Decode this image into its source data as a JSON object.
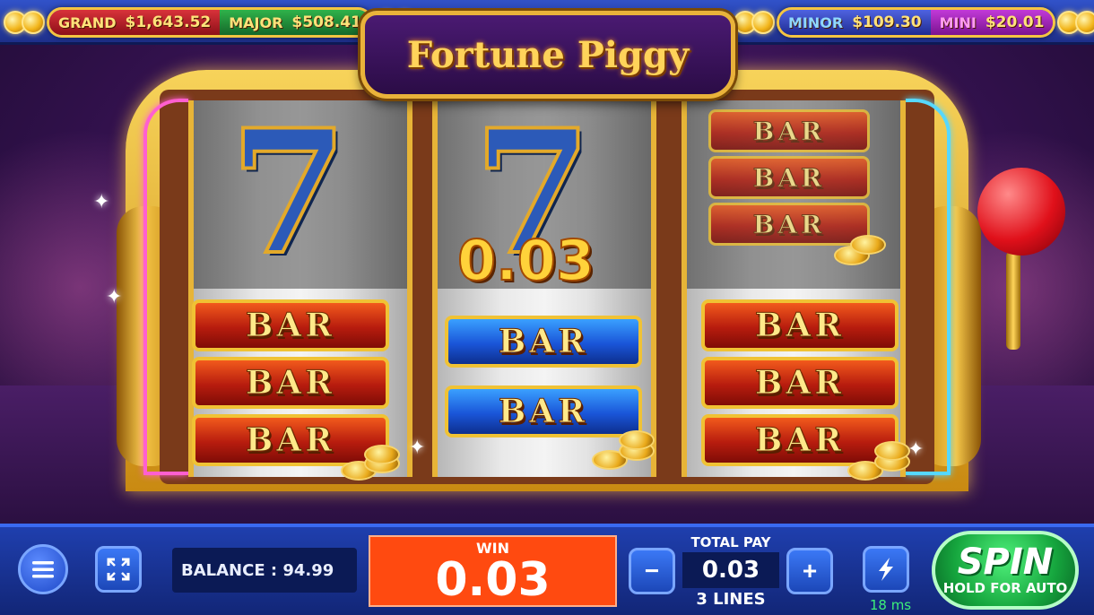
{
  "game": {
    "title": "Fortune Piggy"
  },
  "jackpots": {
    "grand": {
      "label": "GRAND",
      "value": "$1,643.52"
    },
    "major": {
      "label": "MAJOR",
      "value": "$508.41"
    },
    "minor": {
      "label": "MINOR",
      "value": "$109.30"
    },
    "mini": {
      "label": "MINI",
      "value": "$20.01"
    }
  },
  "reels": {
    "reel1": {
      "top_symbol": "7",
      "bars": [
        "BAR",
        "BAR",
        "BAR"
      ]
    },
    "reel2": {
      "top_symbol": "7",
      "overlay_amount": "0.03",
      "bars": [
        "BAR",
        "BAR"
      ]
    },
    "reel3": {
      "top_bars": [
        "BAR",
        "BAR",
        "BAR"
      ],
      "bars": [
        "BAR",
        "BAR",
        "BAR"
      ]
    }
  },
  "controls": {
    "menu_icon": "hamburger-menu-icon",
    "fullscreen_icon": "fullscreen-icon",
    "balance_text": "BALANCE : 94.99",
    "win_label": "WIN",
    "win_value": "0.03",
    "total_pay_label": "TOTAL PAY",
    "total_pay_value": "0.03",
    "decrease_symbol": "−",
    "increase_symbol": "+",
    "lines_text": "3  LINES",
    "turbo_icon": "lightning-icon",
    "latency_text": "18 ms",
    "spin_label": "SPIN",
    "spin_sublabel": "HOLD FOR AUTO"
  },
  "colors": {
    "spin_green": "#16a63e",
    "win_orange": "#ff4a10",
    "panel_blue": "#1f3fae",
    "gold": "#f0c234"
  }
}
